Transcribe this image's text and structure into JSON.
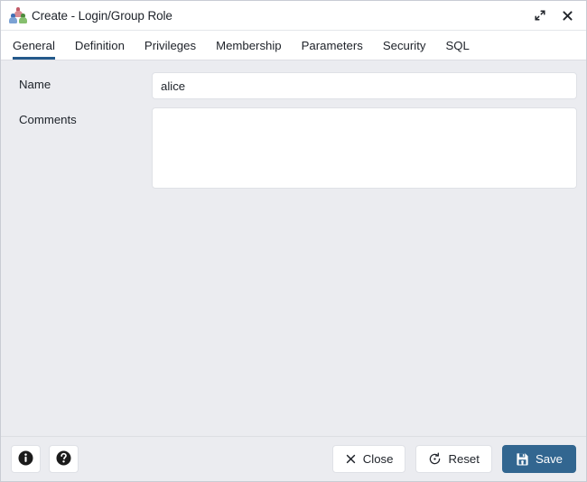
{
  "window": {
    "title": "Create - Login/Group Role",
    "app_icon": "group-role-icon",
    "controls": {
      "maximize_label": "Maximize",
      "maximize_icon": "expand-diagonal-icon",
      "close_label": "Close",
      "close_icon": "close-icon"
    }
  },
  "tabs": [
    {
      "label": "General",
      "active": true
    },
    {
      "label": "Definition",
      "active": false
    },
    {
      "label": "Privileges",
      "active": false
    },
    {
      "label": "Membership",
      "active": false
    },
    {
      "label": "Parameters",
      "active": false
    },
    {
      "label": "Security",
      "active": false
    },
    {
      "label": "SQL",
      "active": false
    }
  ],
  "form": {
    "name": {
      "label": "Name",
      "value": "alice",
      "placeholder": ""
    },
    "comments": {
      "label": "Comments",
      "value": "",
      "placeholder": ""
    }
  },
  "footer": {
    "info": {
      "label": "Info",
      "icon": "info-circle-icon"
    },
    "help": {
      "label": "Help",
      "icon": "question-circle-icon"
    },
    "close": {
      "label": "Close",
      "icon": "close-x-icon"
    },
    "reset": {
      "label": "Reset",
      "icon": "reset-circular-arrow-icon"
    },
    "save": {
      "label": "Save",
      "icon": "save-floppy-icon"
    }
  },
  "colors": {
    "accent": "#326690",
    "active_tab_underline": "#24598b",
    "body_background": "#ebecf0",
    "panel_background": "#ffffff",
    "border": "#dfe1e6",
    "text": "#1d2229"
  }
}
